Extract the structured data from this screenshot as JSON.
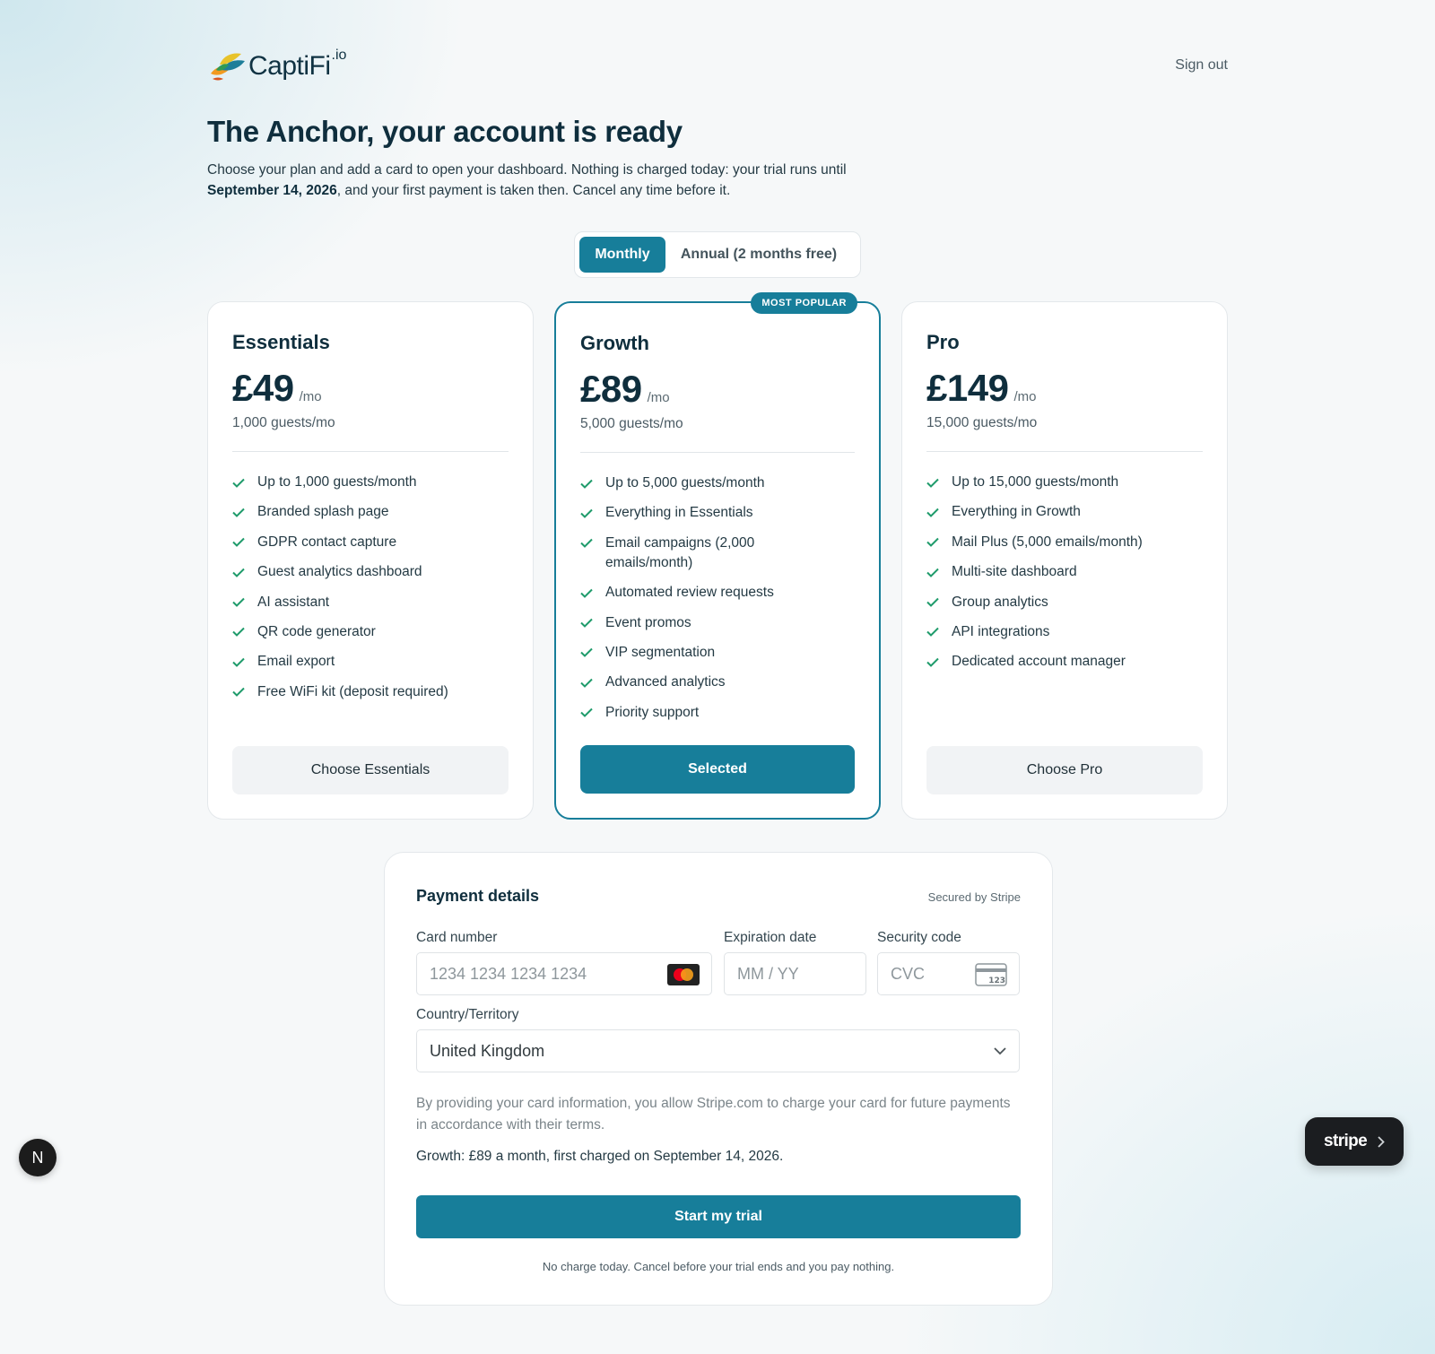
{
  "brand": {
    "name": "CaptiFi",
    "suffix": ".io",
    "colors": {
      "primary": "#177e9a",
      "check": "#1f9b6b",
      "text": "#0f2e3d"
    }
  },
  "header": {
    "signout_label": "Sign out"
  },
  "page": {
    "title": "The Anchor, your account is ready",
    "intro_before": "Choose your plan and add a card to open your dashboard. Nothing is charged today: your trial runs until",
    "intro_date": "September 14, 2026",
    "intro_after": ", and your first payment is taken then. Cancel any time before it."
  },
  "billing_toggle": {
    "options": [
      "Monthly",
      "Annual (2 months free)"
    ],
    "selected": "Monthly"
  },
  "plans": [
    {
      "name": "Essentials",
      "price": "£49",
      "period": "/mo",
      "guests": "1,000 guests/mo",
      "features": [
        "Up to 1,000 guests/month",
        "Branded splash page",
        "GDPR contact capture",
        "Guest analytics dashboard",
        "AI assistant",
        "QR code generator",
        "Email export",
        "Free WiFi kit (deposit required)"
      ],
      "cta": "Choose Essentials"
    },
    {
      "name": "Growth",
      "badge": "MOST POPULAR",
      "price": "£89",
      "period": "/mo",
      "guests": "5,000 guests/mo",
      "features": [
        "Up to 5,000 guests/month",
        "Everything in Essentials",
        "Email campaigns (2,000 emails/month)",
        "Automated review requests",
        "Event promos",
        "VIP segmentation",
        "Advanced analytics",
        "Priority support"
      ],
      "cta": "Selected"
    },
    {
      "name": "Pro",
      "price": "£149",
      "period": "/mo",
      "guests": "15,000 guests/mo",
      "features": [
        "Up to 15,000 guests/month",
        "Everything in Growth",
        "Mail Plus (5,000 emails/month)",
        "Multi-site dashboard",
        "Group analytics",
        "API integrations",
        "Dedicated account manager"
      ],
      "cta": "Choose Pro"
    }
  ],
  "payment": {
    "title": "Payment details",
    "secured": "Secured by Stripe",
    "card_number": {
      "label": "Card number",
      "placeholder": "1234 1234 1234 1234",
      "icon": "mastercard-icon"
    },
    "expiry": {
      "label": "Expiration date",
      "placeholder": "MM / YY"
    },
    "cvc": {
      "label": "Security code",
      "placeholder": "CVC",
      "icon": "cvc-card-icon",
      "icon_text": "123"
    },
    "country": {
      "label": "Country/Territory",
      "value": "United Kingdom"
    },
    "disclaimer": "By providing your card information, you allow Stripe.com to charge your card for future payments in accordance with their terms.",
    "summary": "Growth: £89 a month, first charged on September 14, 2026.",
    "submit": "Start my trial",
    "footnote": "No charge today. Cancel before your trial ends and you pay nothing."
  },
  "floating": {
    "dev_badge": "N",
    "stripe_label": "stripe"
  }
}
